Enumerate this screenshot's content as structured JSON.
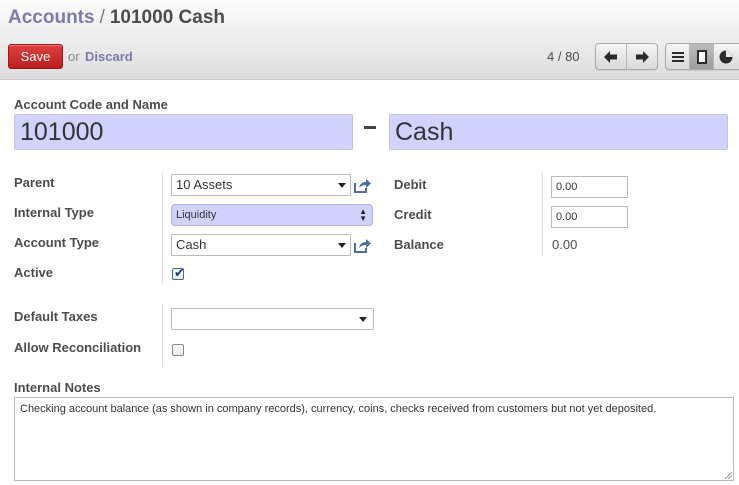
{
  "header": {
    "breadcrumb_parent": "Accounts",
    "breadcrumb_separator": "/",
    "breadcrumb_current": "101000 Cash",
    "save_label": "Save",
    "or_label": "or",
    "discard_label": "Discard",
    "pager": "4 / 80",
    "colors": {
      "save": "#c42b2b",
      "link": "#7c7bad"
    }
  },
  "form": {
    "code_name_label": "Account Code and Name",
    "code_value": "101000",
    "name_value": "Cash",
    "parent_label": "Parent",
    "parent_value": "10 Assets",
    "internal_type_label": "Internal Type",
    "internal_type_value": "Liquidity",
    "account_type_label": "Account Type",
    "account_type_value": "Cash",
    "active_label": "Active",
    "active_checked": true,
    "debit_label": "Debit",
    "debit_value": "0.00",
    "credit_label": "Credit",
    "credit_value": "0.00",
    "balance_label": "Balance",
    "balance_value": "0.00",
    "default_taxes_label": "Default Taxes",
    "default_taxes_value": "",
    "allow_reconciliation_label": "Allow Reconciliation",
    "allow_reconciliation_checked": false,
    "internal_notes_label": "Internal Notes",
    "internal_notes_value": "Checking account balance (as shown in company records), currency, coins, checks received from customers but not yet deposited.",
    "colors": {
      "required_field": "#d2d2ff"
    }
  },
  "icons": {
    "pager_prev": "arrow-left-icon",
    "pager_next": "arrow-right-icon",
    "view_list": "list-view-icon",
    "view_form": "form-view-icon",
    "view_other": "chart-view-icon",
    "external": "external-link-icon"
  }
}
